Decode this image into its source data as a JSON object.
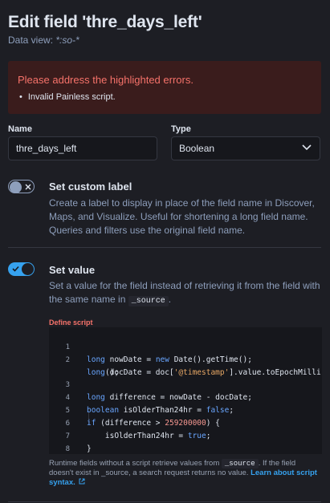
{
  "header": {
    "title": "Edit field 'thre_days_left'",
    "subtitle_prefix": "Data view:",
    "subtitle_value": "*:so-*"
  },
  "callout": {
    "title": "Please address the highlighted errors.",
    "items": [
      "Invalid Painless script."
    ]
  },
  "name_field": {
    "label": "Name",
    "value": "thre_days_left"
  },
  "type_field": {
    "label": "Type",
    "value": "Boolean"
  },
  "custom_label": {
    "toggle_state": "off",
    "title": "Set custom label",
    "description": "Create a label to display in place of the field name in Discover, Maps, and Visualize. Useful for shortening a long field name. Queries and filters use the original field name."
  },
  "set_value": {
    "toggle_state": "on",
    "title": "Set value",
    "description_prefix": "Set a value for the field instead of retrieving it from the field with the same name in",
    "description_code": "_source",
    "description_suffix": "."
  },
  "script": {
    "label": "Define script",
    "line_numbers": [
      "1",
      "2",
      "",
      "3",
      "4",
      "5",
      "6",
      "7",
      "8"
    ]
  },
  "help": {
    "prefix": "Runtime fields without a script retrieve values from",
    "code": "_source",
    "middle": ". If the field doesn't exist in _source, a search request returns no value.",
    "link": "Learn about script syntax."
  },
  "colors": {
    "accent": "#36a2ef",
    "danger": "#f6726a",
    "background": "#1d1e24"
  }
}
